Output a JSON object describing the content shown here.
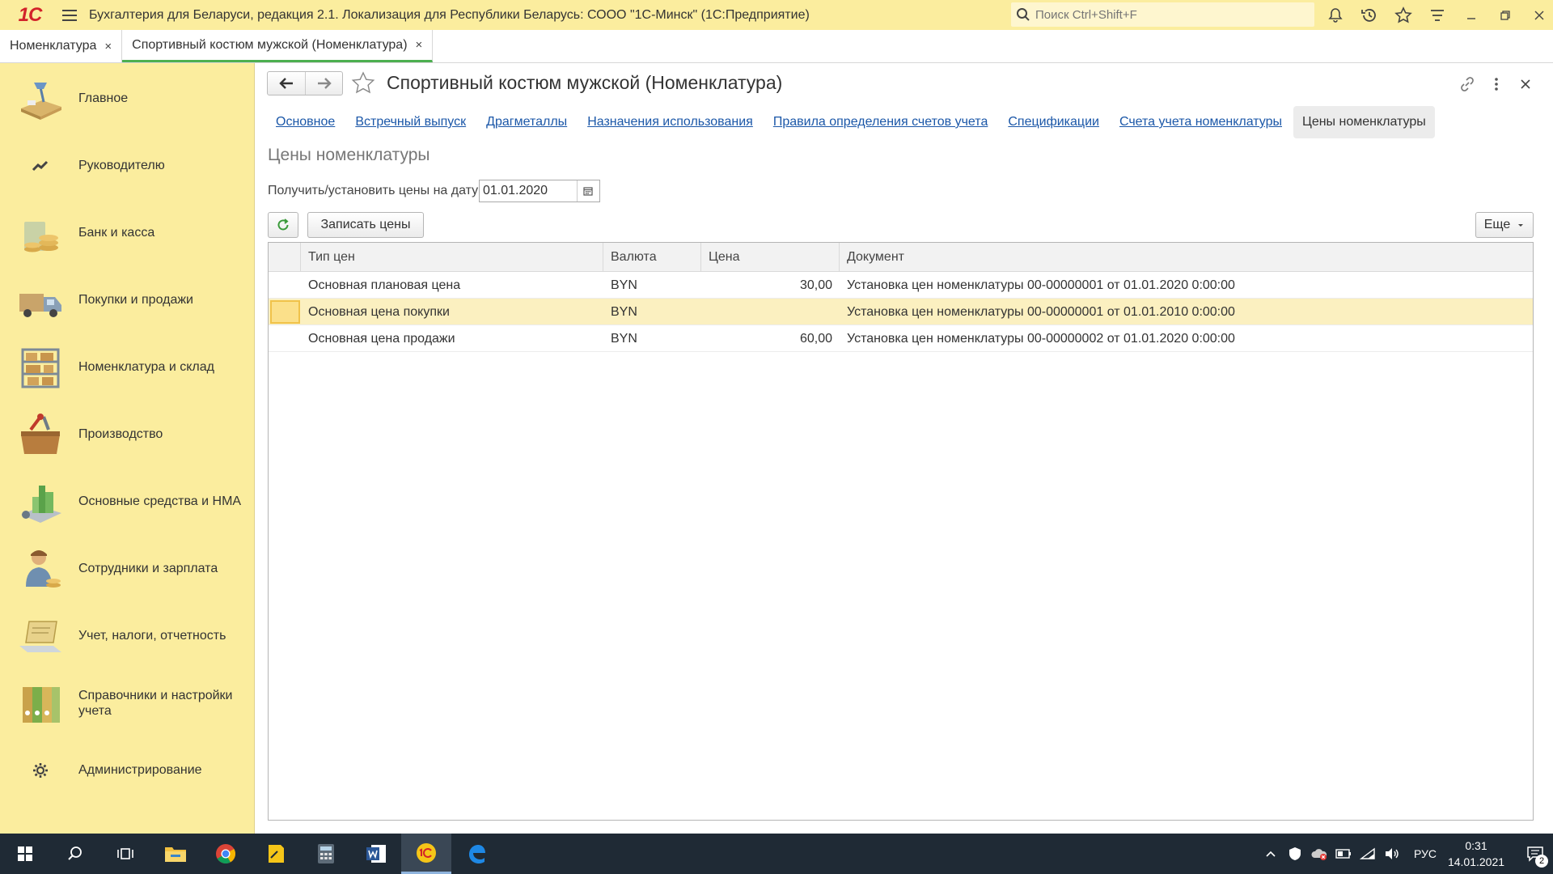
{
  "app": {
    "logo": "1С",
    "title": "Бухгалтерия для Беларуси, редакция 2.1. Локализация для Республики Беларусь: СООО \"1С-Минск\"  (1С:Предприятие)",
    "search_placeholder": "Поиск Ctrl+Shift+F"
  },
  "open_tabs": [
    {
      "label": "Номенклатура",
      "close": "×"
    },
    {
      "label": "Спортивный костюм мужской (Номенклатура)",
      "close": "×"
    }
  ],
  "sidebar": {
    "items": [
      {
        "label": "Главное",
        "icon": "desk-lamp-icon"
      },
      {
        "label": "Руководителю",
        "icon": "chart-trend-icon"
      },
      {
        "label": "Банк и касса",
        "icon": "coins-icon"
      },
      {
        "label": "Покупки и продажи",
        "icon": "truck-icon"
      },
      {
        "label": "Номенклатура и склад",
        "icon": "warehouse-shelf-icon"
      },
      {
        "label": "Производство",
        "icon": "toolbox-icon"
      },
      {
        "label": "Основные средства и НМА",
        "icon": "building-icon"
      },
      {
        "label": "Сотрудники и зарплата",
        "icon": "worker-icon"
      },
      {
        "label": "Учет, налоги, отчетность",
        "icon": "laptop-icon"
      },
      {
        "label": "Справочники и настройки учета",
        "icon": "binders-icon"
      },
      {
        "label": "Администрирование",
        "icon": "gear-icon"
      }
    ]
  },
  "form": {
    "title": "Спортивный костюм мужской (Номенклатура)",
    "tabs": [
      {
        "label": "Основное"
      },
      {
        "label": "Встречный выпуск"
      },
      {
        "label": "Драгметаллы"
      },
      {
        "label": "Назначения использования"
      },
      {
        "label": "Правила определения счетов учета"
      },
      {
        "label": "Спецификации"
      },
      {
        "label": "Счета учета номенклатуры"
      },
      {
        "label": "Цены номенклатуры"
      }
    ],
    "section_title": "Цены номенклатуры",
    "date_label": "Получить/установить цены на дату:",
    "date_value": "01.01.2020",
    "write_button": "Записать цены",
    "more_button": "Еще"
  },
  "grid": {
    "columns": [
      "Тип цен",
      "Валюта",
      "Цена",
      "Документ"
    ],
    "rows": [
      {
        "type": "Основная плановая цена",
        "currency": "BYN",
        "price": "30,00",
        "document": "Установка цен номенклатуры 00-00000001 от 01.01.2020 0:00:00"
      },
      {
        "type": "Основная цена покупки",
        "currency": "BYN",
        "price": "",
        "document": "Установка цен номенклатуры 00-00000001 от 01.01.2010 0:00:00"
      },
      {
        "type": "Основная цена продажи",
        "currency": "BYN",
        "price": "60,00",
        "document": "Установка цен номенклатуры 00-00000002 от 01.01.2020 0:00:00"
      }
    ]
  },
  "taskbar": {
    "lang": "РУС",
    "time": "0:31",
    "date": "14.01.2021",
    "notifications": "2"
  },
  "colors": {
    "accent_yellow": "#fbed9e",
    "link_blue": "#1b57a8",
    "selected_row": "#fbf0c0",
    "active_tab_underline": "#4caf50"
  }
}
